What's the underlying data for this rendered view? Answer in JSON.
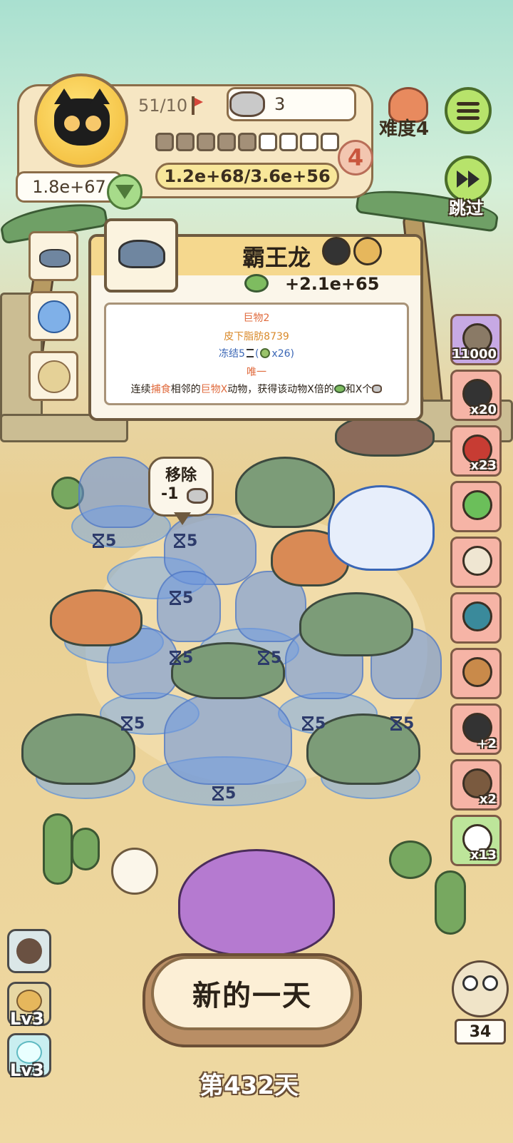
{
  "hud": {
    "capacity": "51/10",
    "can_count": "3",
    "power": "1.8e+67",
    "progress_text": "1.2e+68/3.6e+56",
    "level": "4",
    "segments_filled": 5,
    "segments_total": 9
  },
  "difficulty": {
    "label": "难度4"
  },
  "skip": {
    "label": "跳过"
  },
  "menu": {
    "icon": "menu-icon"
  },
  "popup": {
    "title": "霸王龙",
    "stat_value": "+2.1e+65",
    "lines": {
      "line1": "巨物2",
      "line2": "皮下脂肪8739",
      "line3_a": "冻结5",
      "line3_b": "(",
      "line3_c": "x26)",
      "line4": "唯一",
      "line5_a": "连续",
      "line5_b": "捕食",
      "line5_c": "相邻的",
      "line5_d": "巨物X",
      "line5_e": "动物，获得该动物X倍的",
      "line5_f": "和X个"
    }
  },
  "bubble": {
    "title": "移除",
    "cost": "-1"
  },
  "freeze_tags": [
    "5",
    "5",
    "5",
    "5",
    "5",
    "5",
    "5",
    "5",
    "5"
  ],
  "items": [
    {
      "count": "11000",
      "color": "purple",
      "icon": "shell-icon"
    },
    {
      "count": "x20",
      "color": "pink",
      "icon": "bomb-icon"
    },
    {
      "count": "x23",
      "color": "pink",
      "icon": "sack-icon"
    },
    {
      "count": "",
      "color": "pink",
      "icon": "potion-icon"
    },
    {
      "count": "",
      "color": "pink",
      "icon": "skeleton-icon"
    },
    {
      "count": "",
      "color": "pink",
      "icon": "shrine-icon"
    },
    {
      "count": "",
      "color": "pink",
      "icon": "gingerbread-icon"
    },
    {
      "count": "+2",
      "color": "pink",
      "icon": "paw-bomb-icon"
    },
    {
      "count": "x2",
      "color": "pink",
      "icon": "turtle-icon"
    },
    {
      "count": "x13",
      "color": "green",
      "icon": "tea-icon"
    }
  ],
  "bottom": {
    "new_day": "新的一天",
    "day": "第432天",
    "lv1": "Lv3",
    "lv2": "Lv3",
    "owl_count": "34"
  },
  "colors": {
    "accent": "#f5d88e",
    "highlight": "#e06b3e",
    "freeze": "#3a66b5"
  }
}
